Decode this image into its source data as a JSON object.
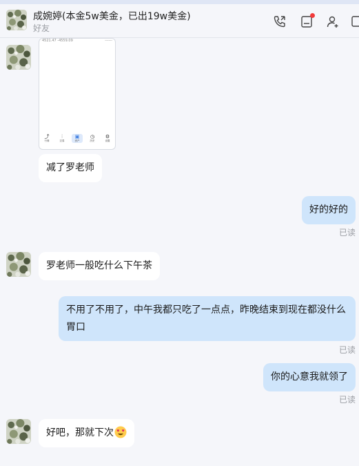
{
  "header": {
    "title": "成婉婷(本金5w美金，已出19w美金)",
    "subtitle": "好友",
    "icons": [
      "phone-icon",
      "inbox-icon",
      "add-user-icon",
      "more-icon"
    ],
    "notification_color": "#f23a3a"
  },
  "screenshot_card": {
    "top_left_text": "4521.47  -4559.09",
    "top_right_text": "------",
    "tabs": [
      {
        "glyph": "⤴",
        "label": "行情"
      },
      {
        "glyph": "⫶",
        "label": "交易"
      },
      {
        "glyph": "▣",
        "label": "资产"
      },
      {
        "glyph": "◷",
        "label": "历史"
      },
      {
        "glyph": "⚙",
        "label": "设置"
      }
    ]
  },
  "messages": [
    {
      "side": "in",
      "text": "减了罗老师"
    },
    {
      "side": "out",
      "text": "好的好的",
      "status": "已读"
    },
    {
      "side": "in",
      "text": "罗老师一般吃什么下午茶"
    },
    {
      "side": "out",
      "text": "不用了不用了，中午我都只吃了一点点，昨晚结束到现在都没什么胃口",
      "status": "已读"
    },
    {
      "side": "out",
      "text": "你的心意我就领了",
      "status": "已读"
    },
    {
      "side": "in",
      "text": "好吧，那就下次",
      "emoji": "face-with-heart-eyes"
    }
  ],
  "colors": {
    "outgoing_bubble": "#cfe5fb",
    "incoming_bubble": "#ffffff",
    "background": "#f5f6fa"
  }
}
